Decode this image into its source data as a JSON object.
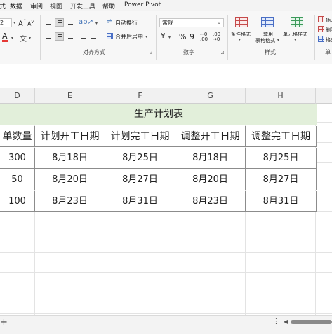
{
  "menu": {
    "items": [
      "式",
      "数据",
      "审阅",
      "视图",
      "开发工具",
      "帮助",
      "Power Pivot"
    ]
  },
  "ribbon": {
    "font_size": "2",
    "grow_font": "A",
    "shrink_font": "A",
    "wrap_text": "自动换行",
    "merge_center": "合并后居中",
    "number_format": "常规",
    "currency_symbol": "¥",
    "percent_symbol": "%",
    "comma_symbol": "9",
    "conditional_format": "条件格式",
    "format_table_1": "套用",
    "format_table_2": "表格格式",
    "cell_styles": "单元格样式",
    "insert_label": "插入",
    "delete_label": "删除",
    "format_label": "格式",
    "group_alignment": "对齐方式",
    "group_number": "数字",
    "group_styles": "样式",
    "group_cells": "单",
    "font_color_accent": "#e53935"
  },
  "columns": [
    "D",
    "E",
    "F",
    "G",
    "H"
  ],
  "table": {
    "title": "生产计划表",
    "title_fill": "#e2efda",
    "headers": [
      "单数量",
      "计划开工日期",
      "计划完工日期",
      "调整开工日期",
      "调整完工日期"
    ],
    "rows": [
      [
        "300",
        "8月18日",
        "8月25日",
        "8月18日",
        "8月25日"
      ],
      [
        "50",
        "8月20日",
        "8月27日",
        "8月20日",
        "8月27日"
      ],
      [
        "100",
        "8月23日",
        "8月31日",
        "8月23日",
        "8月31日"
      ]
    ]
  },
  "bottom": {
    "add_sheet": "+",
    "more": "⋮",
    "scroll_left": "◀"
  }
}
